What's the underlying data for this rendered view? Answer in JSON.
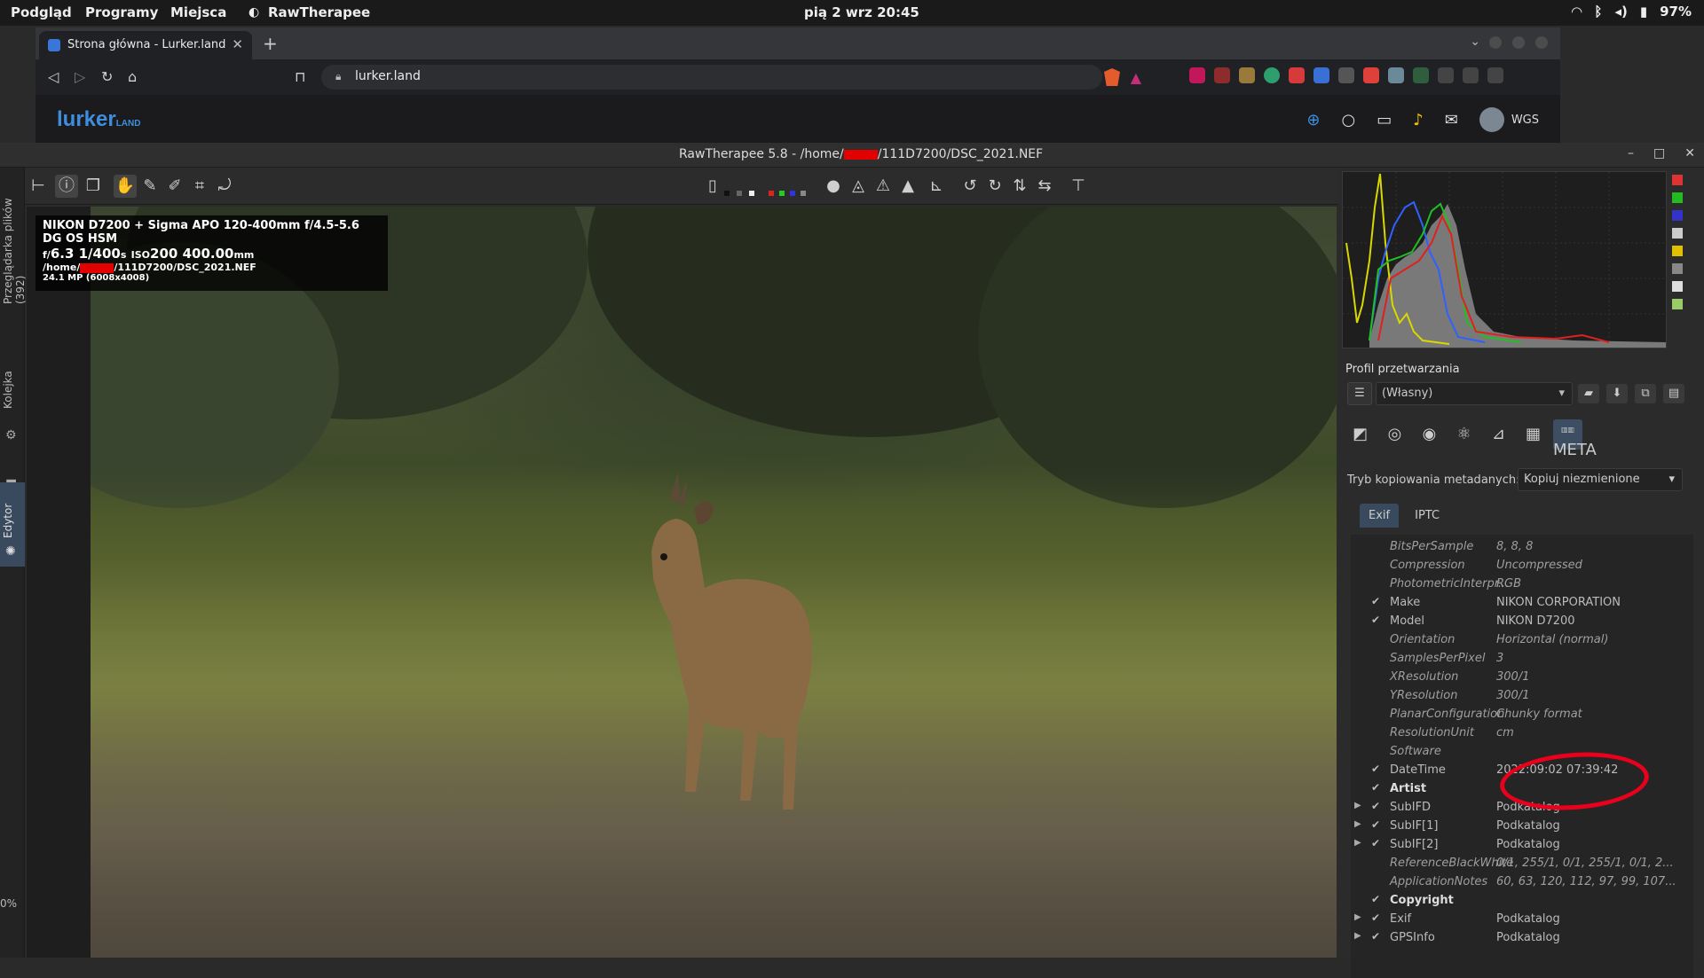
{
  "topbar": {
    "menus": [
      "Podgląd",
      "Programy",
      "Miejsca",
      "RawTherapee"
    ],
    "clock": "pią 2 wrz  20:45",
    "battery": "97%"
  },
  "browser": {
    "tab_title": "Strona główna - Lurker.land",
    "url": "lurker.land",
    "site_logo": "lurker",
    "site_logo_suffix": "LAND",
    "user": "WGS"
  },
  "rt": {
    "title_prefix": "RawTherapee 5.8 - /home/",
    "title_suffix": "/111D7200/DSC_2021.NEF",
    "side_tabs": [
      "Przeglądarka plików (392)",
      "Kolejka",
      "Edytor"
    ],
    "zoom_label": "0%",
    "overlay": {
      "camera": "NIKON D7200 + Sigma APO 120-400mm f/4.5-5.6 DG OS HSM",
      "exposure_f": "f/",
      "aperture": "6.3",
      "shutter": "1/400",
      "shutter_unit": "s",
      "iso_label": "ISO",
      "iso": "200",
      "focal": "400.00",
      "focal_unit": "mm",
      "path_prefix": "/home/",
      "path_suffix": "/111D7200/DSC_2021.NEF",
      "megapixels": "24.1 MP (6008x4008)"
    },
    "profile_label": "Profil przetwarzania",
    "profile_value": "(Własny)",
    "meta_mode_label": "Tryb kopiowania metadanych:",
    "meta_mode_value": "Kopiuj niezmienione",
    "subtabs": [
      "Exif",
      "IPTC"
    ],
    "meta_tab_label": "META",
    "exif_rows": [
      {
        "key": "BitsPerSample",
        "value": "8, 8, 8",
        "style": "it",
        "check": "",
        "exp": ""
      },
      {
        "key": "Compression",
        "value": "Uncompressed",
        "style": "it",
        "check": "",
        "exp": ""
      },
      {
        "key": "PhotometricInterpr...",
        "value": "RGB",
        "style": "it",
        "check": "",
        "exp": ""
      },
      {
        "key": "Make",
        "value": "NIKON CORPORATION",
        "style": "",
        "check": "✔",
        "exp": ""
      },
      {
        "key": "Model",
        "value": "NIKON D7200",
        "style": "",
        "check": "✔",
        "exp": ""
      },
      {
        "key": "Orientation",
        "value": "Horizontal (normal)",
        "style": "it",
        "check": "",
        "exp": ""
      },
      {
        "key": "SamplesPerPixel",
        "value": "3",
        "style": "it",
        "check": "",
        "exp": ""
      },
      {
        "key": "XResolution",
        "value": "300/1",
        "style": "it",
        "check": "",
        "exp": ""
      },
      {
        "key": "YResolution",
        "value": "300/1",
        "style": "it",
        "check": "",
        "exp": ""
      },
      {
        "key": "PlanarConfiguration",
        "value": "Chunky format",
        "style": "it",
        "check": "",
        "exp": ""
      },
      {
        "key": "ResolutionUnit",
        "value": "cm",
        "style": "it",
        "check": "",
        "exp": ""
      },
      {
        "key": "Software",
        "value": "",
        "style": "it",
        "check": "",
        "exp": ""
      },
      {
        "key": "DateTime",
        "value": "2022:09:02 07:39:42",
        "style": "",
        "check": "✔",
        "exp": ""
      },
      {
        "key": "Artist",
        "value": "",
        "style": "bold",
        "check": "✔",
        "exp": ""
      },
      {
        "key": "SubIFD",
        "value": "Podkatalog",
        "style": "",
        "check": "✔",
        "exp": "▶"
      },
      {
        "key": "SubIF[1]",
        "value": "Podkatalog",
        "style": "",
        "check": "✔",
        "exp": "▶"
      },
      {
        "key": "SubIF[2]",
        "value": "Podkatalog",
        "style": "",
        "check": "✔",
        "exp": "▶"
      },
      {
        "key": "ReferenceBlackWhite",
        "value": "0/1, 255/1, 0/1, 255/1, 0/1, 2...",
        "style": "it",
        "check": "",
        "exp": ""
      },
      {
        "key": "ApplicationNotes",
        "value": "60, 63, 120, 112, 97, 99, 107...",
        "style": "it",
        "check": "",
        "exp": ""
      },
      {
        "key": "Copyright",
        "value": "",
        "style": "bold",
        "check": "✔",
        "exp": ""
      },
      {
        "key": "Exif",
        "value": "Podkatalog",
        "style": "",
        "check": "✔",
        "exp": "▶"
      },
      {
        "key": "GPSInfo",
        "value": "Podkatalog",
        "style": "",
        "check": "✔",
        "exp": "▶"
      }
    ]
  },
  "colors": {
    "accent_blue": "#3e8ee0",
    "highlight_red": "#e8001c",
    "active_tab": "#3a4a5e"
  }
}
